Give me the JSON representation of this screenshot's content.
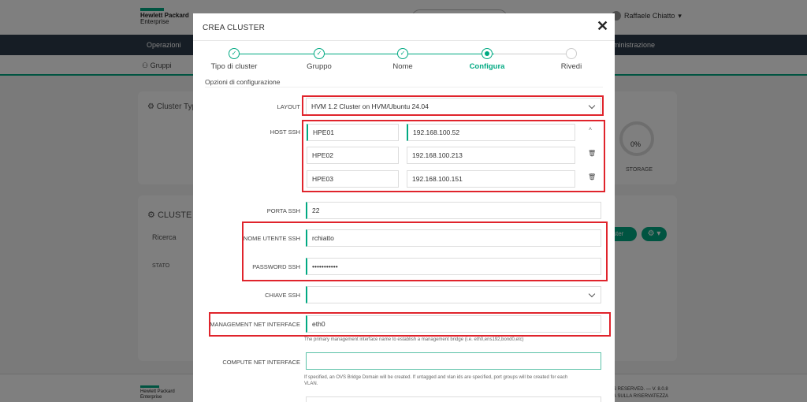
{
  "background": {
    "logo_line1": "Hewlett Packard",
    "logo_line2": "Enterprise",
    "user_name": "Raffaele Chiatto",
    "nav_left": "Operazioni",
    "nav_right": "ministrazione",
    "subnav_groups": "Gruppi",
    "card1_title": "Cluster Typ",
    "gauge_percent": "0%",
    "gauge_label": "STORAGE",
    "card2_title": "CLUSTE",
    "search_placeholder": "Ricerca",
    "column_status": "STATO",
    "cluster_button": "ster",
    "footer_logo_line1": "Hewlett Packard",
    "footer_logo_line2": "Enterprise",
    "footer_right1": "S RESERVED. — V. 8.0.8",
    "footer_right2": "A SULLA RISERVATEZZA"
  },
  "modal": {
    "title": "CREA CLUSTER",
    "close_icon": "close-icon",
    "steps": [
      {
        "label": "Tipo di cluster",
        "state": "done"
      },
      {
        "label": "Gruppo",
        "state": "done"
      },
      {
        "label": "Nome",
        "state": "done"
      },
      {
        "label": "Configura",
        "state": "active"
      },
      {
        "label": "Rivedi",
        "state": "pending"
      }
    ],
    "section_title": "Opzioni di configurazione",
    "fields": {
      "layout_label": "LAYOUT",
      "layout_value": "HVM 1.2 Cluster on HVM/Ubuntu 24.04",
      "host_ssh_label": "HOST SSH",
      "hosts": [
        {
          "name": "HPE01",
          "ip": "192.168.100.52"
        },
        {
          "name": "HPE02",
          "ip": "192.168.100.213"
        },
        {
          "name": "HPE03",
          "ip": "192.168.100.151"
        }
      ],
      "port_label": "PORTA SSH",
      "port_value": "22",
      "user_label": "NOME UTENTE SSH",
      "user_value": "rchiatto",
      "password_label": "PASSWORD SSH",
      "password_value": "•••••••••••",
      "key_label": "CHIAVE SSH",
      "key_value": "",
      "mgmt_label": "MANAGEMENT NET INTERFACE",
      "mgmt_value": "eth0",
      "mgmt_help": "The primary management interface name to establish a management bridge (i.e. eth0,ens192,bond0,etc)",
      "compute_label": "COMPUTE NET INTERFACE",
      "compute_value": "",
      "compute_help_1": "If specified, an OVS Bridge Domain will be created. If untagged and vlan ids are specified, port groups will be created for each",
      "compute_help_2": "VLAN."
    }
  },
  "colors": {
    "accent": "#01a982",
    "highlight": "#e0242c"
  }
}
